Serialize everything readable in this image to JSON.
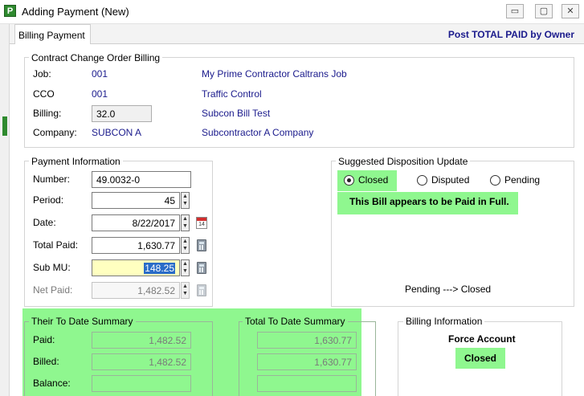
{
  "window": {
    "title": "Adding Payment  (New)",
    "app_icon_letter": "P",
    "minimize": "▭",
    "maximize": "▢",
    "close": "✕"
  },
  "tabs": [
    {
      "label": "Billing Payment"
    }
  ],
  "post_link": "Post TOTAL PAID by Owner",
  "cco_billing": {
    "legend": "Contract Change Order Billing",
    "job_label": "Job:",
    "job_code": "001",
    "job_name": "My Prime Contractor Caltrans Job",
    "cco_label": "CCO",
    "cco_code": "001",
    "cco_name": "Traffic Control",
    "billing_label": "Billing:",
    "billing_value": "32.0",
    "billing_name": "Subcon Bill Test",
    "company_label": "Company:",
    "company_code": "SUBCON A",
    "company_name": "Subcontractor A Company"
  },
  "payment_info": {
    "legend": "Payment Information",
    "number_label": "Number:",
    "number_value": "49.0032-0",
    "period_label": "Period:",
    "period_value": "45",
    "date_label": "Date:",
    "date_value": "8/22/2017",
    "calendar_day": "14",
    "total_paid_label": "Total Paid:",
    "total_paid_value": "1,630.77",
    "sub_mu_label": "Sub MU:",
    "sub_mu_value": "148.25",
    "net_paid_label": "Net Paid:",
    "net_paid_value": "1,482.52"
  },
  "disposition": {
    "legend": "Suggested Disposition Update",
    "options": [
      "Closed",
      "Disputed",
      "Pending"
    ],
    "selected": "Closed",
    "message": "This Bill appears to be Paid in Full.",
    "transition": "Pending ---> Closed"
  },
  "their_summary": {
    "legend": "Their To Date Summary",
    "paid_label": "Paid:",
    "paid_value": "1,482.52",
    "billed_label": "Billed:",
    "billed_value": "1,482.52",
    "balance_label": "Balance:",
    "balance_value": ""
  },
  "total_summary": {
    "legend": "Total To Date Summary",
    "paid_value": "1,630.77",
    "billed_value": "1,630.77",
    "balance_value": ""
  },
  "billing_info": {
    "legend": "Billing Information",
    "type": "Force Account",
    "status": "Closed"
  },
  "icons": {
    "spin_up": "▲",
    "spin_down": "▼"
  },
  "colors": {
    "highlight": "#8ff78f",
    "link_blue": "#1a1a8c",
    "selection": "#2a6cc8",
    "edit_yellow": "#ffffc0"
  }
}
